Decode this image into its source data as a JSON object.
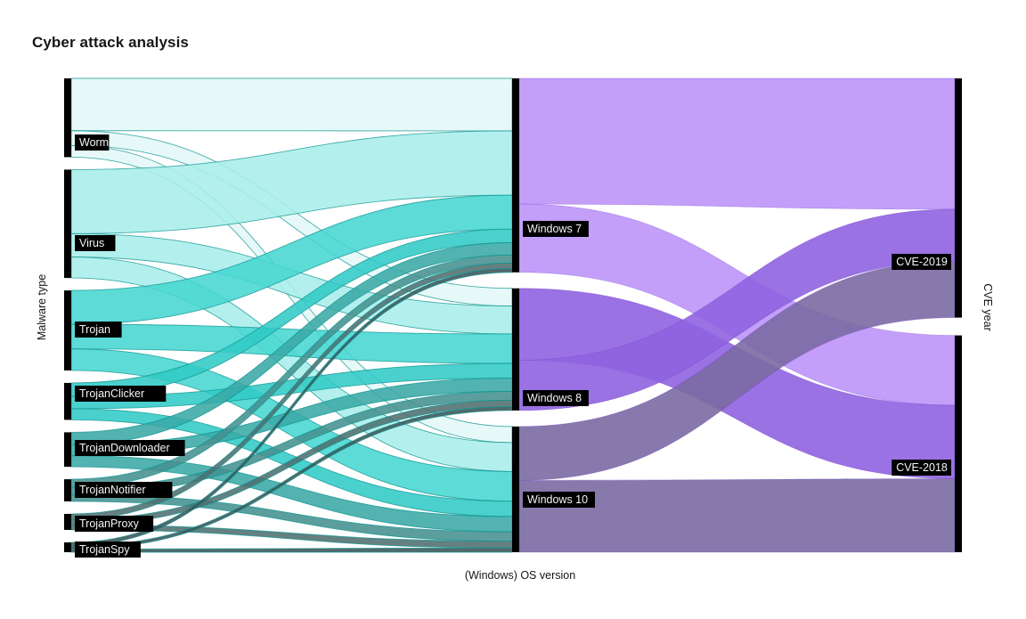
{
  "title": "Cyber attack analysis",
  "axes": {
    "left_label": "Malware type",
    "bottom_label": "(Windows) OS version",
    "right_label": "CVE year"
  },
  "colors": {
    "background": "#ffffff",
    "title": "#161616",
    "node_bar": "#000000",
    "label_box": "#000000",
    "label_text": "#f4f4f4",
    "flow_worm": "#e2f8f7",
    "flow_virus": "#a8eeea",
    "flow_trojan": "#45d6d2",
    "flow_trojanclicker": "#31c9c6",
    "flow_trojandownloader": "#3aa9a6",
    "flow_trojannotifier": "#46918f",
    "flow_trojanproxy": "#4f6e70",
    "flow_trojanspy": "#3c5356",
    "flow_windows7": "#bd95fa",
    "flow_windows8": "#8f63e0",
    "flow_windows10": "#7a6aa3",
    "flow_dark_purple": "#4b2a7b",
    "stroke_teal": "#0e9490",
    "stroke_purple": "#6b35c9"
  },
  "chart_data": {
    "type": "sankey",
    "title": "Cyber attack analysis",
    "columns": [
      {
        "key": "malware",
        "label": "Malware type",
        "position": "left"
      },
      {
        "key": "os",
        "label": "(Windows) OS version",
        "position": "middle"
      },
      {
        "key": "cve",
        "label": "CVE year",
        "position": "right"
      }
    ],
    "nodes": [
      {
        "id": "worm",
        "label": "Worm",
        "column": "malware",
        "value": 128,
        "color": "#e2f8f7"
      },
      {
        "id": "virus",
        "label": "Virus",
        "column": "malware",
        "value": 176,
        "color": "#a8eeea"
      },
      {
        "id": "trojan",
        "label": "Trojan",
        "column": "malware",
        "value": 130,
        "color": "#45d6d2"
      },
      {
        "id": "trojanclicker",
        "label": "TrojanClicker",
        "column": "malware",
        "value": 60,
        "color": "#31c9c6"
      },
      {
        "id": "trojandownloader",
        "label": "TrojanDownloader",
        "column": "malware",
        "value": 56,
        "color": "#3aa9a6"
      },
      {
        "id": "trojannotifier",
        "label": "TrojanNotifier",
        "column": "malware",
        "value": 36,
        "color": "#46918f"
      },
      {
        "id": "trojanproxy",
        "label": "TrojanProxy",
        "column": "malware",
        "value": 26,
        "color": "#4f6e70"
      },
      {
        "id": "trojanspy",
        "label": "TrojanSpy",
        "column": "malware",
        "value": 16,
        "color": "#3c5356"
      },
      {
        "id": "windows7",
        "label": "Windows 7",
        "column": "os",
        "value": 270,
        "color": "#bd95fa"
      },
      {
        "id": "windows8",
        "label": "Windows 8",
        "column": "os",
        "value": 170,
        "color": "#8f63e0"
      },
      {
        "id": "windows10",
        "label": "Windows 10",
        "column": "os",
        "value": 175,
        "color": "#7a6aa3"
      },
      {
        "id": "cve2019",
        "label": "CVE-2019",
        "column": "cve",
        "value": 320,
        "color": "#bd95fa"
      },
      {
        "id": "cve2018",
        "label": "CVE-2018",
        "column": "cve",
        "value": 290,
        "color": "#8f63e0"
      }
    ],
    "links": [
      {
        "source": "worm",
        "target": "windows7",
        "value": 85
      },
      {
        "source": "worm",
        "target": "windows8",
        "value": 24
      },
      {
        "source": "worm",
        "target": "windows10",
        "value": 19
      },
      {
        "source": "virus",
        "target": "windows7",
        "value": 104
      },
      {
        "source": "virus",
        "target": "windows8",
        "value": 38
      },
      {
        "source": "virus",
        "target": "windows10",
        "value": 34
      },
      {
        "source": "trojan",
        "target": "windows7",
        "value": 55
      },
      {
        "source": "trojan",
        "target": "windows8",
        "value": 40
      },
      {
        "source": "trojan",
        "target": "windows10",
        "value": 35
      },
      {
        "source": "trojanclicker",
        "target": "windows7",
        "value": 22
      },
      {
        "source": "trojanclicker",
        "target": "windows8",
        "value": 20
      },
      {
        "source": "trojanclicker",
        "target": "windows10",
        "value": 18
      },
      {
        "source": "trojandownloader",
        "target": "windows7",
        "value": 20
      },
      {
        "source": "trojandownloader",
        "target": "windows8",
        "value": 18
      },
      {
        "source": "trojandownloader",
        "target": "windows10",
        "value": 18
      },
      {
        "source": "trojannotifier",
        "target": "windows7",
        "value": 13
      },
      {
        "source": "trojannotifier",
        "target": "windows8",
        "value": 12
      },
      {
        "source": "trojannotifier",
        "target": "windows10",
        "value": 11
      },
      {
        "source": "trojanproxy",
        "target": "windows7",
        "value": 9
      },
      {
        "source": "trojanproxy",
        "target": "windows8",
        "value": 9
      },
      {
        "source": "trojanproxy",
        "target": "windows10",
        "value": 8
      },
      {
        "source": "trojanspy",
        "target": "windows7",
        "value": 6
      },
      {
        "source": "trojanspy",
        "target": "windows8",
        "value": 5
      },
      {
        "source": "trojanspy",
        "target": "windows10",
        "value": 5
      },
      {
        "source": "windows7",
        "target": "cve2019",
        "value": 175
      },
      {
        "source": "windows7",
        "target": "cve2018",
        "value": 95
      },
      {
        "source": "windows8",
        "target": "cve2019",
        "value": 70
      },
      {
        "source": "windows8",
        "target": "cve2018",
        "value": 100
      },
      {
        "source": "windows10",
        "target": "cve2019",
        "value": 75
      },
      {
        "source": "windows10",
        "target": "cve2018",
        "value": 100
      }
    ]
  }
}
